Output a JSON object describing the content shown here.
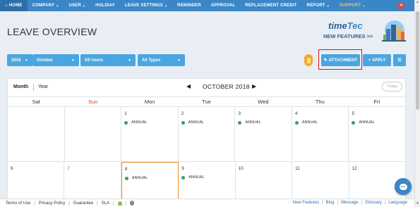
{
  "nav": {
    "items": [
      {
        "label": "HOME",
        "active": true,
        "caret": false
      },
      {
        "label": "COMPANY",
        "caret": true
      },
      {
        "label": "USER",
        "caret": true
      },
      {
        "label": "HOLIDAY",
        "caret": false
      },
      {
        "label": "LEAVE SETTINGS",
        "caret": true
      },
      {
        "label": "REMINDER",
        "caret": false
      },
      {
        "label": "APPROVAL",
        "caret": false
      },
      {
        "label": "REPLACEMENT CREDIT",
        "caret": false
      },
      {
        "label": "REPORT",
        "caret": true
      },
      {
        "label": "SUPPORT",
        "caret": true
      }
    ],
    "bg_color": "#3b86c6",
    "support_color": "#f5c451"
  },
  "page_title": "LEAVE OVERVIEW",
  "banner": {
    "logo_time": "time",
    "logo_tec": "Tec",
    "text": "NEW FEATURES >>"
  },
  "filters": {
    "year": "2018",
    "month": "October",
    "users": "All Users",
    "types": "All Types"
  },
  "buttons": {
    "attachment": "ATTACHMENT",
    "apply": "APPLY"
  },
  "calendar": {
    "views": [
      "Month",
      "Year"
    ],
    "month_title": "OCTOBER 2018",
    "prev": "◀",
    "next": "▶",
    "today": "Today",
    "days_of_week": [
      "Sat",
      "Sun",
      "Mon",
      "Tue",
      "Wed",
      "Thu",
      "Fri"
    ],
    "weeks": [
      [
        {
          "day": "",
          "event": ""
        },
        {
          "day": "",
          "event": ""
        },
        {
          "day": "1",
          "event": "ANNUAL"
        },
        {
          "day": "2",
          "event": "ANNUAL"
        },
        {
          "day": "3",
          "event": "ANNUAL"
        },
        {
          "day": "4",
          "event": "ANNUAL"
        },
        {
          "day": "5",
          "event": "ANNUAL"
        }
      ],
      [
        {
          "day": "6",
          "event": ""
        },
        {
          "day": "7",
          "event": ""
        },
        {
          "day": "8",
          "event": "ANNUAL"
        },
        {
          "day": "9",
          "event": "ANNUAL"
        },
        {
          "day": "10",
          "event": ""
        },
        {
          "day": "11",
          "event": ""
        },
        {
          "day": "12",
          "event": ""
        }
      ]
    ],
    "today_highlight_color": "#f08a2a",
    "event_color": "#3a9c5c",
    "sunday_color": "#d6402b"
  },
  "footer": {
    "left": [
      "Terms of Use",
      "Privacy Policy",
      "Guarantee",
      "SLA"
    ],
    "right": [
      "New Features",
      "Blog",
      "Message",
      "Glossary",
      "Language"
    ]
  }
}
